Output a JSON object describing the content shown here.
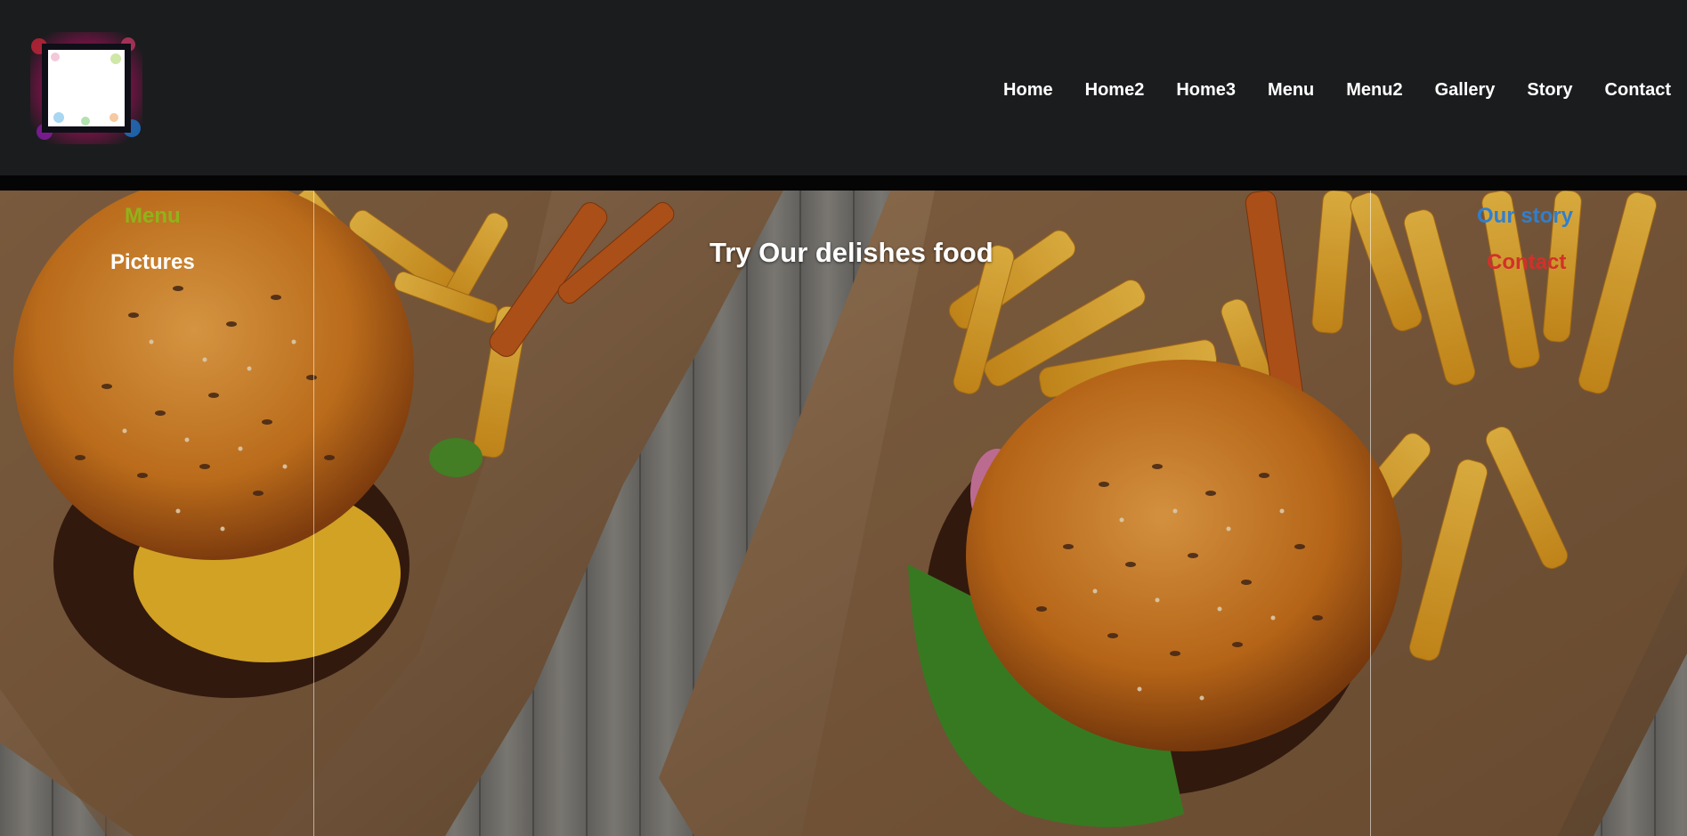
{
  "nav": {
    "items": [
      "Home",
      "Home2",
      "Home3",
      "Menu",
      "Menu2",
      "Gallery",
      "Story",
      "Contact"
    ]
  },
  "hero": {
    "title": "Try Our delishes food",
    "left_links": [
      {
        "label": "Menu",
        "color": "#8fb319"
      },
      {
        "label": "Pictures",
        "color": "#ffffff"
      }
    ],
    "right_links": [
      {
        "label": "Our story",
        "color": "#2f7fd0"
      },
      {
        "label": "Contact",
        "color": "#d3302a"
      }
    ]
  },
  "logo": {
    "icon": "gallery-frame-logo-icon"
  }
}
